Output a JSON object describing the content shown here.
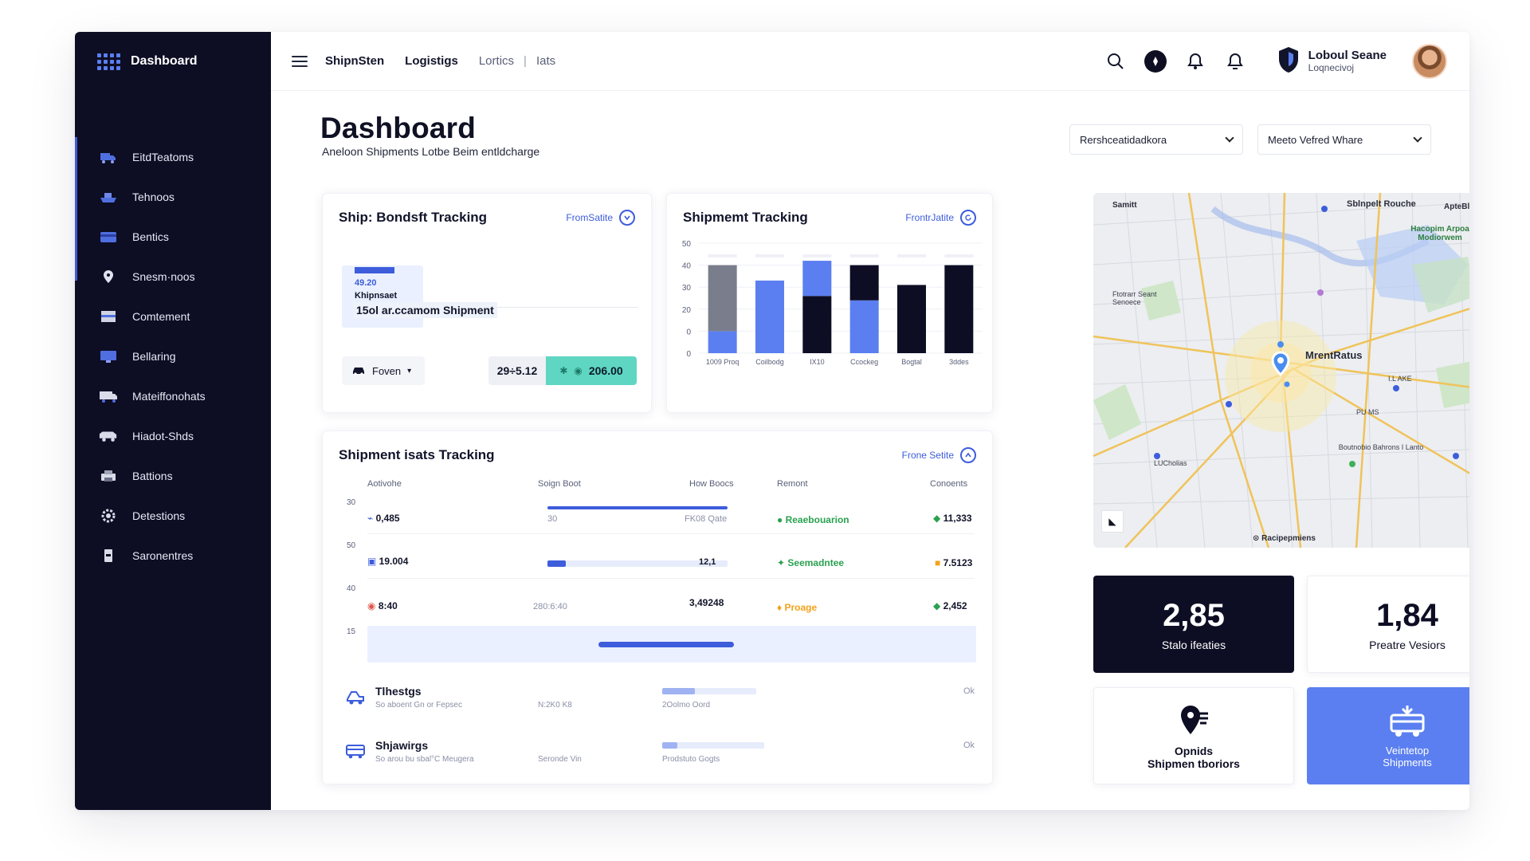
{
  "brand": {
    "name": "Dashboard"
  },
  "sidebar": {
    "items": [
      {
        "label": "EitdTeatoms",
        "icon": "truck-icon"
      },
      {
        "label": "Tehnoos",
        "icon": "ship-icon"
      },
      {
        "label": "Bentics",
        "icon": "card-icon"
      },
      {
        "label": "Snesm·noos",
        "icon": "location-pin-icon"
      },
      {
        "label": "Comtement",
        "icon": "box-icon"
      },
      {
        "label": "Bellaring",
        "icon": "monitor-icon"
      },
      {
        "label": "Mateiffonohats",
        "icon": "truck-icon"
      },
      {
        "label": "Hiadot-Shds",
        "icon": "van-icon"
      },
      {
        "label": "Battions",
        "icon": "printer-icon"
      },
      {
        "label": "Detestions",
        "icon": "settings-icon"
      },
      {
        "label": "Saronentres",
        "icon": "device-icon"
      }
    ]
  },
  "topbar": {
    "nav": [
      "ShipnSten",
      "Logistigs",
      "Lortics",
      "|",
      "Iats"
    ],
    "user": {
      "name": "Loboul Seane",
      "role": "Loqnecivoj"
    }
  },
  "header": {
    "title": "Dashboard",
    "subtitle": "Aneloon Shipments Lotbe Beim entldcharge",
    "select1": "Rershceatidadkora",
    "select2": "Meeto Vefred Whare"
  },
  "card1": {
    "title": "Ship: Bondsft Tracking",
    "link": "FromSatite",
    "mini_value": "49.20",
    "mini_label": "Khipnsaet",
    "mini_desc": "15ol ar.ccamom Shipment",
    "filter_label": "Foven",
    "range_left": "29÷5.12",
    "range_right": "206.00"
  },
  "card2": {
    "title": "Shipmemt Tracking",
    "link": "FrontrJatite"
  },
  "chart_data": {
    "type": "bar",
    "categories": [
      "1009 Proq",
      "Coilbodg",
      "IX10",
      "Ccockeg",
      "Bogtal",
      "3ddes"
    ],
    "ytick_labels": [
      "50",
      "40",
      "30",
      "20",
      "0",
      "0"
    ],
    "ylim": [
      0,
      50
    ],
    "series": [
      {
        "values": [
          0,
          0,
          0,
          0,
          0,
          0
        ]
      }
    ],
    "bars": [
      {
        "segments": [
          {
            "value": 10,
            "color": "#5b7ff0"
          },
          {
            "value": 30,
            "color": "#7a7d8c"
          }
        ]
      },
      {
        "segments": [
          {
            "value": 33,
            "color": "#5b7ff0"
          }
        ]
      },
      {
        "segments": [
          {
            "value": 26,
            "color": "#0d0d24"
          },
          {
            "value": 16,
            "color": "#5b7ff0"
          }
        ]
      },
      {
        "segments": [
          {
            "value": 24,
            "color": "#5b7ff0"
          },
          {
            "value": 16,
            "color": "#0d0d24"
          }
        ]
      },
      {
        "segments": [
          {
            "value": 31,
            "color": "#0d0d24"
          }
        ]
      },
      {
        "segments": [
          {
            "value": 40,
            "color": "#0d0d24"
          }
        ]
      }
    ],
    "title": "Shipmemt Tracking",
    "xlabel": "",
    "ylabel": ""
  },
  "card3": {
    "title": "Shipment isats Tracking",
    "link": "Frone Setite",
    "headers": [
      "Aotivohe",
      "Soign Boot",
      "How Boocs",
      "Remont",
      "Conoents"
    ],
    "y_labels": [
      "30",
      "50",
      "40",
      "15"
    ],
    "rows": [
      {
        "id": "0,485",
        "mid": "30",
        "progress": 1.0,
        "meta": "FK08 Qate",
        "status": "Reaebouarion",
        "status_type": "green",
        "amount": "11,333"
      },
      {
        "id": "19.004",
        "mid": "",
        "progress": 0.1,
        "meta": "12,1",
        "status": "Seemadntee",
        "status_type": "green",
        "amount": "7.5123"
      },
      {
        "id": "8:40",
        "mid": "280:6:40",
        "progress": 0,
        "meta": "3,49248",
        "status": "Proage",
        "status_type": "orange",
        "amount": "2,452"
      }
    ],
    "list": [
      {
        "title": "Tlhestgs",
        "sub": "So aboent Gn or Fepsec",
        "mid": "N:2K0 K8",
        "bar_label": "2Oolmo Oord",
        "progress": 0.35,
        "end": "Ok"
      },
      {
        "title": "Shjawirgs",
        "sub": "So arou bu sbal°C Meugera",
        "mid": "Seronde Vin",
        "bar_label": "Prodstuto Gogts",
        "progress": 0.15,
        "end": "Ok"
      }
    ]
  },
  "map": {
    "labels": {
      "tl": "Samitt",
      "top": "Sblnpelt Rouche",
      "tr": "ApteBlossoke",
      "park": "Hacopim Arpoa Modiorwem",
      "left": "Ftotrarr Seant Senoece",
      "center": "MrentRatus",
      "right_small": "I.L AKE",
      "mid_right": "PU MS",
      "bottom_right": "Boutnobio Bahrons I Lanto",
      "bottom_left": "LUCholias",
      "footer": "Racipepmiens"
    }
  },
  "stats": [
    {
      "value": "2,85",
      "label": "Stalo ifeaties"
    },
    {
      "value": "1,84",
      "label": "Preatre Vesiors"
    }
  ],
  "actions": [
    {
      "title": "Opnids",
      "sub": "Shipmen tboriors"
    },
    {
      "title": "Veintetop",
      "sub": "Shipments"
    }
  ],
  "colors": {
    "accent": "#3d5ddb",
    "sidebar": "#0d0d24",
    "teal": "#5fd6c2",
    "tile_blue": "#5b7ff0"
  }
}
